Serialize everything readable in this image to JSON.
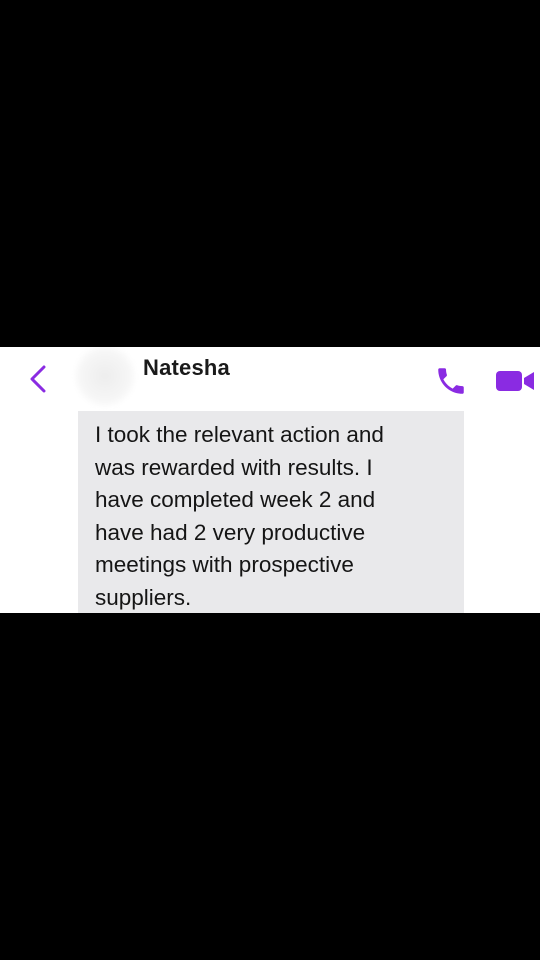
{
  "header": {
    "contact_name": "Natesha",
    "back_icon": "chevron-left-icon",
    "call_icon": "phone-icon",
    "video_icon": "video-camera-icon",
    "accent_color": "#8a2be2"
  },
  "message": {
    "text": "I took the relevant action and\nwas rewarded with results. I\nhave completed week 2 and\nhave had 2 very productive\nmeetings with prospective\nsuppliers.",
    "bubble_color": "#e9e9eb"
  }
}
